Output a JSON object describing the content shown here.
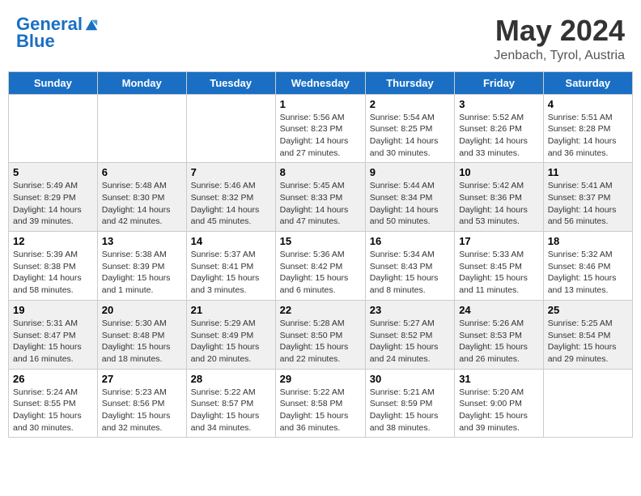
{
  "header": {
    "logo_line1": "General",
    "logo_line2": "Blue",
    "month": "May 2024",
    "location": "Jenbach, Tyrol, Austria"
  },
  "days_of_week": [
    "Sunday",
    "Monday",
    "Tuesday",
    "Wednesday",
    "Thursday",
    "Friday",
    "Saturday"
  ],
  "weeks": [
    [
      {
        "day": "",
        "sunrise": "",
        "sunset": "",
        "daylight": ""
      },
      {
        "day": "",
        "sunrise": "",
        "sunset": "",
        "daylight": ""
      },
      {
        "day": "",
        "sunrise": "",
        "sunset": "",
        "daylight": ""
      },
      {
        "day": "1",
        "sunrise": "Sunrise: 5:56 AM",
        "sunset": "Sunset: 8:23 PM",
        "daylight": "Daylight: 14 hours and 27 minutes."
      },
      {
        "day": "2",
        "sunrise": "Sunrise: 5:54 AM",
        "sunset": "Sunset: 8:25 PM",
        "daylight": "Daylight: 14 hours and 30 minutes."
      },
      {
        "day": "3",
        "sunrise": "Sunrise: 5:52 AM",
        "sunset": "Sunset: 8:26 PM",
        "daylight": "Daylight: 14 hours and 33 minutes."
      },
      {
        "day": "4",
        "sunrise": "Sunrise: 5:51 AM",
        "sunset": "Sunset: 8:28 PM",
        "daylight": "Daylight: 14 hours and 36 minutes."
      }
    ],
    [
      {
        "day": "5",
        "sunrise": "Sunrise: 5:49 AM",
        "sunset": "Sunset: 8:29 PM",
        "daylight": "Daylight: 14 hours and 39 minutes."
      },
      {
        "day": "6",
        "sunrise": "Sunrise: 5:48 AM",
        "sunset": "Sunset: 8:30 PM",
        "daylight": "Daylight: 14 hours and 42 minutes."
      },
      {
        "day": "7",
        "sunrise": "Sunrise: 5:46 AM",
        "sunset": "Sunset: 8:32 PM",
        "daylight": "Daylight: 14 hours and 45 minutes."
      },
      {
        "day": "8",
        "sunrise": "Sunrise: 5:45 AM",
        "sunset": "Sunset: 8:33 PM",
        "daylight": "Daylight: 14 hours and 47 minutes."
      },
      {
        "day": "9",
        "sunrise": "Sunrise: 5:44 AM",
        "sunset": "Sunset: 8:34 PM",
        "daylight": "Daylight: 14 hours and 50 minutes."
      },
      {
        "day": "10",
        "sunrise": "Sunrise: 5:42 AM",
        "sunset": "Sunset: 8:36 PM",
        "daylight": "Daylight: 14 hours and 53 minutes."
      },
      {
        "day": "11",
        "sunrise": "Sunrise: 5:41 AM",
        "sunset": "Sunset: 8:37 PM",
        "daylight": "Daylight: 14 hours and 56 minutes."
      }
    ],
    [
      {
        "day": "12",
        "sunrise": "Sunrise: 5:39 AM",
        "sunset": "Sunset: 8:38 PM",
        "daylight": "Daylight: 14 hours and 58 minutes."
      },
      {
        "day": "13",
        "sunrise": "Sunrise: 5:38 AM",
        "sunset": "Sunset: 8:39 PM",
        "daylight": "Daylight: 15 hours and 1 minute."
      },
      {
        "day": "14",
        "sunrise": "Sunrise: 5:37 AM",
        "sunset": "Sunset: 8:41 PM",
        "daylight": "Daylight: 15 hours and 3 minutes."
      },
      {
        "day": "15",
        "sunrise": "Sunrise: 5:36 AM",
        "sunset": "Sunset: 8:42 PM",
        "daylight": "Daylight: 15 hours and 6 minutes."
      },
      {
        "day": "16",
        "sunrise": "Sunrise: 5:34 AM",
        "sunset": "Sunset: 8:43 PM",
        "daylight": "Daylight: 15 hours and 8 minutes."
      },
      {
        "day": "17",
        "sunrise": "Sunrise: 5:33 AM",
        "sunset": "Sunset: 8:45 PM",
        "daylight": "Daylight: 15 hours and 11 minutes."
      },
      {
        "day": "18",
        "sunrise": "Sunrise: 5:32 AM",
        "sunset": "Sunset: 8:46 PM",
        "daylight": "Daylight: 15 hours and 13 minutes."
      }
    ],
    [
      {
        "day": "19",
        "sunrise": "Sunrise: 5:31 AM",
        "sunset": "Sunset: 8:47 PM",
        "daylight": "Daylight: 15 hours and 16 minutes."
      },
      {
        "day": "20",
        "sunrise": "Sunrise: 5:30 AM",
        "sunset": "Sunset: 8:48 PM",
        "daylight": "Daylight: 15 hours and 18 minutes."
      },
      {
        "day": "21",
        "sunrise": "Sunrise: 5:29 AM",
        "sunset": "Sunset: 8:49 PM",
        "daylight": "Daylight: 15 hours and 20 minutes."
      },
      {
        "day": "22",
        "sunrise": "Sunrise: 5:28 AM",
        "sunset": "Sunset: 8:50 PM",
        "daylight": "Daylight: 15 hours and 22 minutes."
      },
      {
        "day": "23",
        "sunrise": "Sunrise: 5:27 AM",
        "sunset": "Sunset: 8:52 PM",
        "daylight": "Daylight: 15 hours and 24 minutes."
      },
      {
        "day": "24",
        "sunrise": "Sunrise: 5:26 AM",
        "sunset": "Sunset: 8:53 PM",
        "daylight": "Daylight: 15 hours and 26 minutes."
      },
      {
        "day": "25",
        "sunrise": "Sunrise: 5:25 AM",
        "sunset": "Sunset: 8:54 PM",
        "daylight": "Daylight: 15 hours and 29 minutes."
      }
    ],
    [
      {
        "day": "26",
        "sunrise": "Sunrise: 5:24 AM",
        "sunset": "Sunset: 8:55 PM",
        "daylight": "Daylight: 15 hours and 30 minutes."
      },
      {
        "day": "27",
        "sunrise": "Sunrise: 5:23 AM",
        "sunset": "Sunset: 8:56 PM",
        "daylight": "Daylight: 15 hours and 32 minutes."
      },
      {
        "day": "28",
        "sunrise": "Sunrise: 5:22 AM",
        "sunset": "Sunset: 8:57 PM",
        "daylight": "Daylight: 15 hours and 34 minutes."
      },
      {
        "day": "29",
        "sunrise": "Sunrise: 5:22 AM",
        "sunset": "Sunset: 8:58 PM",
        "daylight": "Daylight: 15 hours and 36 minutes."
      },
      {
        "day": "30",
        "sunrise": "Sunrise: 5:21 AM",
        "sunset": "Sunset: 8:59 PM",
        "daylight": "Daylight: 15 hours and 38 minutes."
      },
      {
        "day": "31",
        "sunrise": "Sunrise: 5:20 AM",
        "sunset": "Sunset: 9:00 PM",
        "daylight": "Daylight: 15 hours and 39 minutes."
      },
      {
        "day": "",
        "sunrise": "",
        "sunset": "",
        "daylight": ""
      }
    ]
  ]
}
